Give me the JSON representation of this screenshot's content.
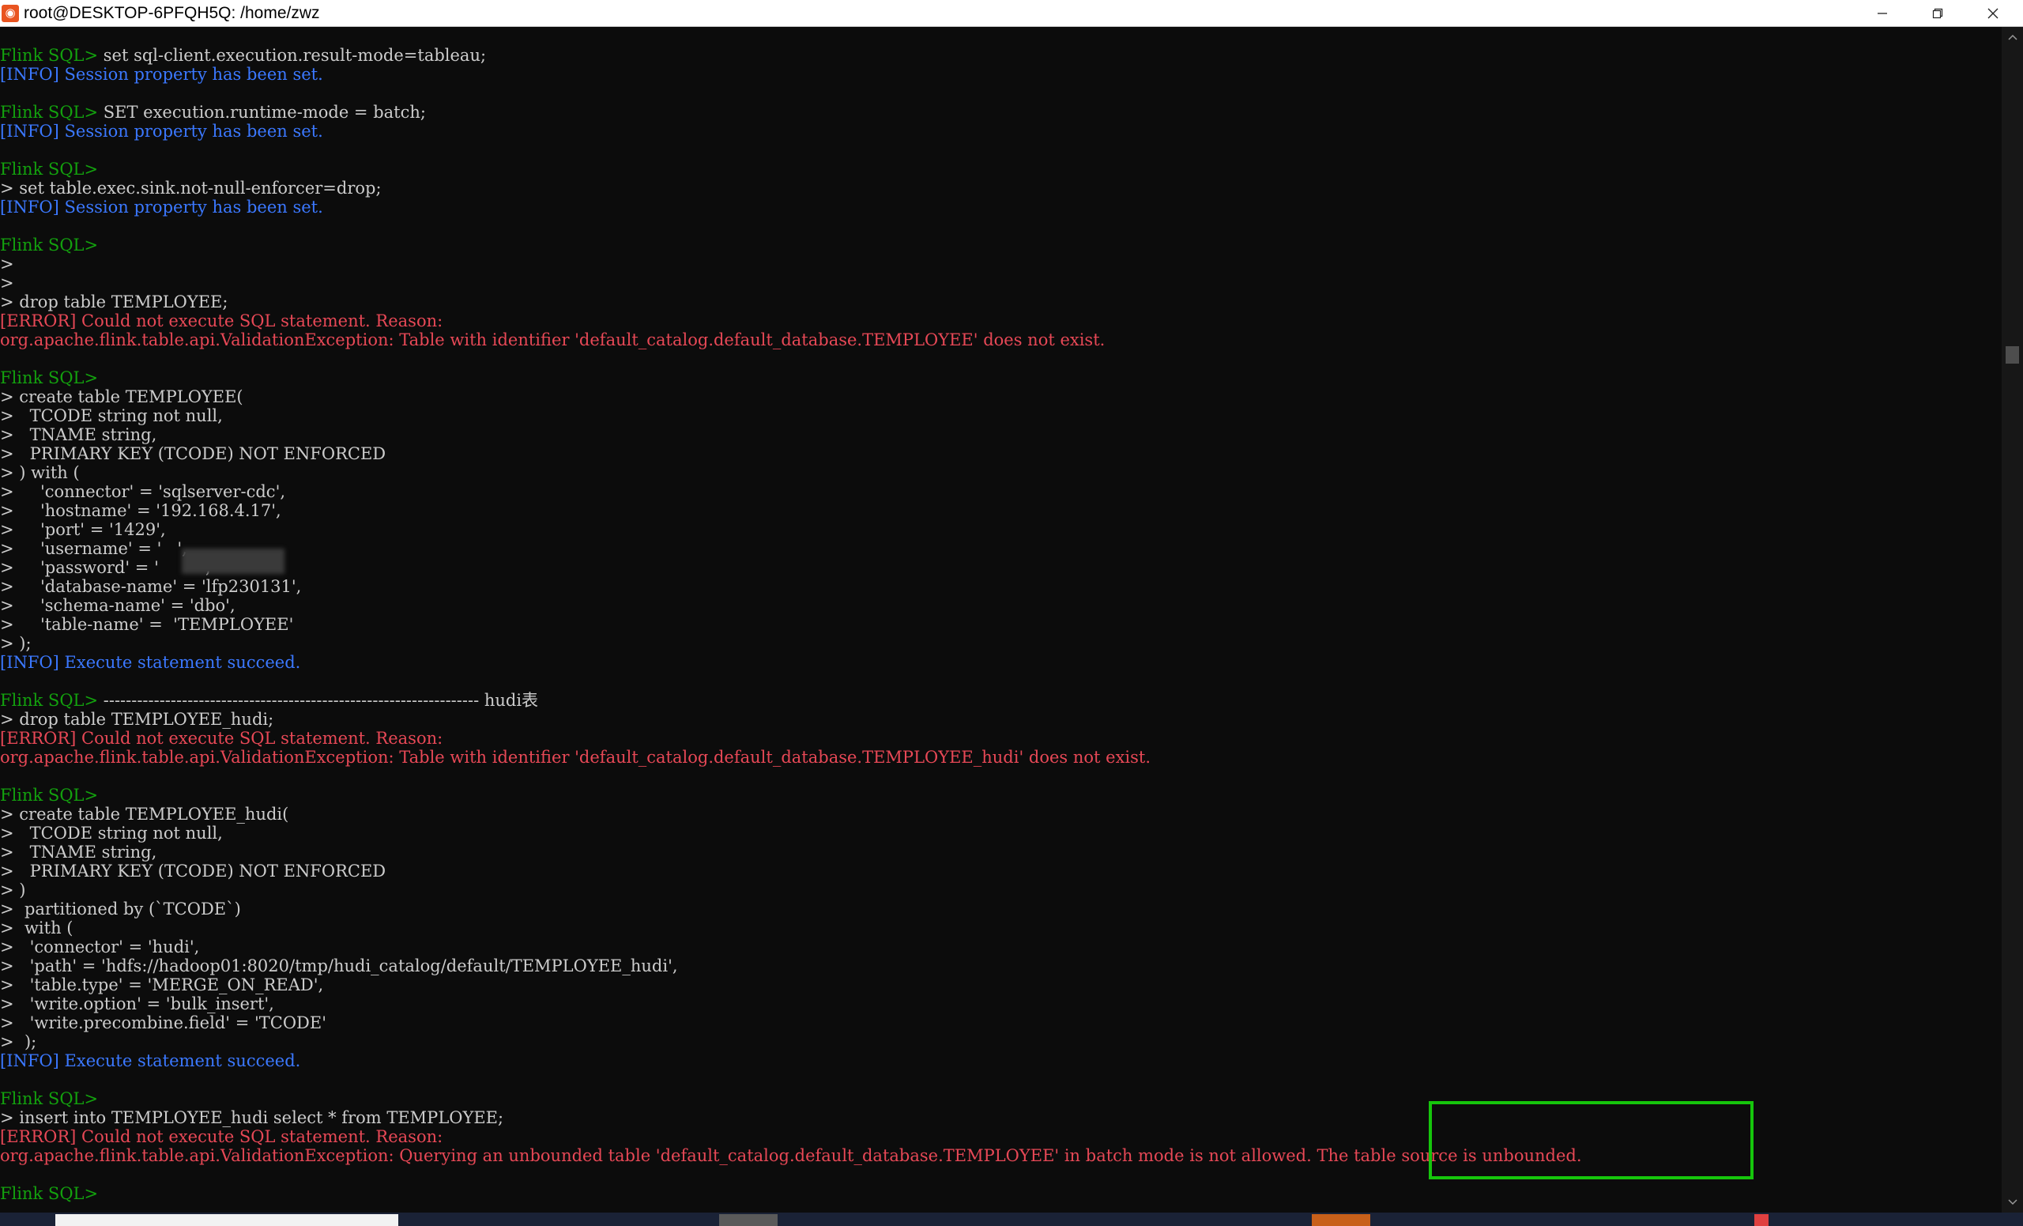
{
  "window": {
    "title": "root@DESKTOP-6PFQH5Q: /home/zwz",
    "app_icon": "ubuntu-icon",
    "controls": [
      "minimize-icon",
      "restore-icon",
      "close-icon"
    ]
  },
  "colors": {
    "prompt": "#13a10e",
    "text": "#cccccc",
    "info": "#3b78ff",
    "error": "#e74856",
    "highlight_box": "#16c60c",
    "background": "#0c0c0c"
  },
  "terminal": {
    "lines": [
      [
        {
          "t": "Flink SQL>",
          "c": "prompt"
        },
        {
          "t": " set sql-client.execution.result-mode=tableau;",
          "c": "text"
        }
      ],
      [
        {
          "t": "[INFO] Session property has been set.",
          "c": "info"
        }
      ],
      [],
      [
        {
          "t": "Flink SQL>",
          "c": "prompt"
        },
        {
          "t": " SET execution.runtime-mode = batch;",
          "c": "text"
        }
      ],
      [
        {
          "t": "[INFO] Session property has been set.",
          "c": "info"
        }
      ],
      [],
      [
        {
          "t": "Flink SQL>",
          "c": "prompt"
        }
      ],
      [
        {
          "t": "> set table.exec.sink.not-null-enforcer=drop;",
          "c": "text"
        }
      ],
      [
        {
          "t": "[INFO] Session property has been set.",
          "c": "info"
        }
      ],
      [],
      [
        {
          "t": "Flink SQL>",
          "c": "prompt"
        }
      ],
      [
        {
          "t": ">",
          "c": "text"
        }
      ],
      [
        {
          "t": ">",
          "c": "text"
        }
      ],
      [
        {
          "t": "> drop table TEMPLOYEE;",
          "c": "text"
        }
      ],
      [
        {
          "t": "[ERROR] Could not execute SQL statement. Reason:",
          "c": "error"
        }
      ],
      [
        {
          "t": "org.apache.flink.table.api.ValidationException: Table with identifier 'default_catalog.default_database.TEMPLOYEE' does not exist.",
          "c": "error"
        }
      ],
      [],
      [
        {
          "t": "Flink SQL>",
          "c": "prompt"
        }
      ],
      [
        {
          "t": "> create table TEMPLOYEE(",
          "c": "text"
        }
      ],
      [
        {
          "t": ">   TCODE string not null,",
          "c": "text"
        }
      ],
      [
        {
          "t": ">   TNAME string,",
          "c": "text"
        }
      ],
      [
        {
          "t": ">   PRIMARY KEY (TCODE) NOT ENFORCED",
          "c": "text"
        }
      ],
      [
        {
          "t": "> ) with (",
          "c": "text"
        }
      ],
      [
        {
          "t": ">     'connector' = 'sqlserver-cdc',",
          "c": "text"
        }
      ],
      [
        {
          "t": ">     'hostname' = '192.168.4.17',",
          "c": "text"
        }
      ],
      [
        {
          "t": ">     'port' = '1429',",
          "c": "text"
        }
      ],
      [
        {
          "t": ">     'username' = '   ',",
          "c": "text"
        }
      ],
      [
        {
          "t": ">     'password' = '        ',",
          "c": "text"
        }
      ],
      [
        {
          "t": ">     'database-name' = 'lfp230131',",
          "c": "text"
        }
      ],
      [
        {
          "t": ">     'schema-name' = 'dbo',",
          "c": "text"
        }
      ],
      [
        {
          "t": ">     'table-name' =  'TEMPLOYEE'",
          "c": "text"
        }
      ],
      [
        {
          "t": "> );",
          "c": "text"
        }
      ],
      [
        {
          "t": "[INFO] Execute statement succeed.",
          "c": "info"
        }
      ],
      [],
      [
        {
          "t": "Flink SQL>",
          "c": "prompt"
        },
        {
          "t": " ------------------------------------------------------------------- hudi表",
          "c": "text"
        }
      ],
      [
        {
          "t": "> drop table TEMPLOYEE_hudi;",
          "c": "text"
        }
      ],
      [
        {
          "t": "[ERROR] Could not execute SQL statement. Reason:",
          "c": "error"
        }
      ],
      [
        {
          "t": "org.apache.flink.table.api.ValidationException: Table with identifier 'default_catalog.default_database.TEMPLOYEE_hudi' does not exist.",
          "c": "error"
        }
      ],
      [],
      [
        {
          "t": "Flink SQL>",
          "c": "prompt"
        }
      ],
      [
        {
          "t": "> create table TEMPLOYEE_hudi(",
          "c": "text"
        }
      ],
      [
        {
          "t": ">   TCODE string not null,",
          "c": "text"
        }
      ],
      [
        {
          "t": ">   TNAME string,",
          "c": "text"
        }
      ],
      [
        {
          "t": ">   PRIMARY KEY (TCODE) NOT ENFORCED",
          "c": "text"
        }
      ],
      [
        {
          "t": "> )",
          "c": "text"
        }
      ],
      [
        {
          "t": ">  partitioned by (`TCODE`)",
          "c": "text"
        }
      ],
      [
        {
          "t": ">  with (",
          "c": "text"
        }
      ],
      [
        {
          "t": ">   'connector' = 'hudi',",
          "c": "text"
        }
      ],
      [
        {
          "t": ">   'path' = 'hdfs://hadoop01:8020/tmp/hudi_catalog/default/TEMPLOYEE_hudi',",
          "c": "text"
        }
      ],
      [
        {
          "t": ">   'table.type' = 'MERGE_ON_READ',",
          "c": "text"
        }
      ],
      [
        {
          "t": ">   'write.option' = 'bulk_insert',",
          "c": "text"
        }
      ],
      [
        {
          "t": ">   'write.precombine.field' = 'TCODE'",
          "c": "text"
        }
      ],
      [
        {
          "t": ">  );",
          "c": "text"
        }
      ],
      [
        {
          "t": "[INFO] Execute statement succeed.",
          "c": "info"
        }
      ],
      [],
      [
        {
          "t": "Flink SQL>",
          "c": "prompt"
        }
      ],
      [
        {
          "t": "> insert into TEMPLOYEE_hudi select * from TEMPLOYEE;",
          "c": "text"
        }
      ],
      [
        {
          "t": "[ERROR] Could not execute SQL statement. Reason:",
          "c": "error"
        }
      ],
      [
        {
          "t": "org.apache.flink.table.api.ValidationException: Querying an unbounded table 'default_catalog.default_database.TEMPLOYEE' in batch mode is not allowed. The table source is unbounded.",
          "c": "error"
        }
      ],
      [],
      [
        {
          "t": "Flink SQL>",
          "c": "prompt"
        }
      ]
    ]
  },
  "annotations": {
    "highlight_label": "green-highlight-box"
  }
}
